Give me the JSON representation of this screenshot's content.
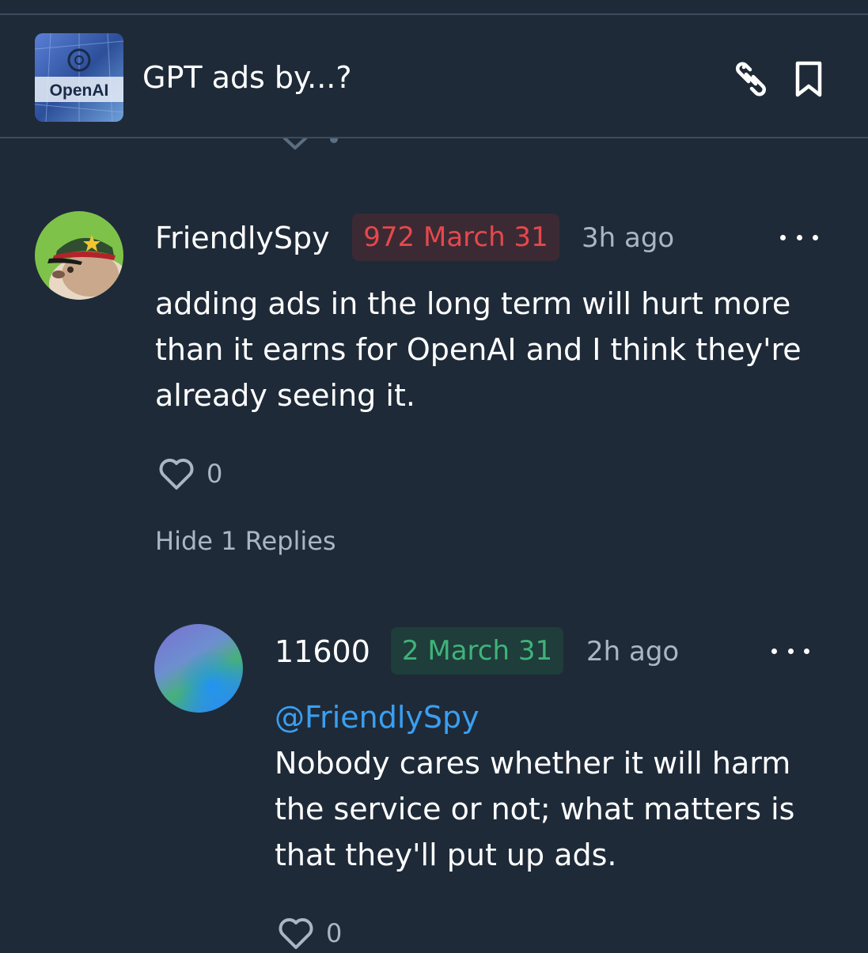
{
  "header": {
    "thumbnail_text": "OpenAI",
    "title": "GPT ads by...?",
    "link_icon": "link-icon",
    "bookmark_icon": "bookmark-icon"
  },
  "comment": {
    "username": "FriendlySpy",
    "badge": "972 March 31",
    "badge_color": "#e5484d",
    "time": "3h ago",
    "body_lines": [
      "adding ads in the long term will hurt more",
      "than it earns for OpenAI and I think they're",
      "already seeing it."
    ],
    "likes": "0",
    "hide_replies": "Hide 1 Replies"
  },
  "reply": {
    "username": "11600",
    "badge": "2 March 31",
    "badge_color": "#3fb37a",
    "time": "2h ago",
    "mention": "@FriendlySpy",
    "body_lines": [
      "Nobody cares whether it will harm",
      "the service or not; what matters is",
      "that they'll put up ads."
    ],
    "likes": "0"
  }
}
